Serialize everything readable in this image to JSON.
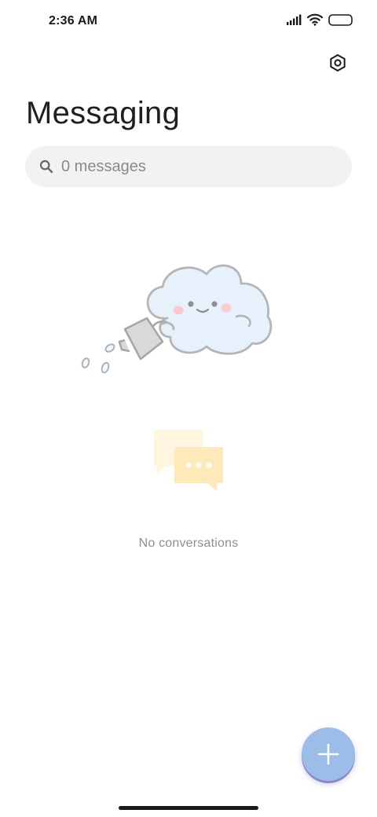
{
  "status_bar": {
    "time": "2:36 AM"
  },
  "header": {
    "title": "Messaging"
  },
  "search": {
    "placeholder": "0 messages",
    "value": ""
  },
  "empty_state": {
    "message": "No conversations"
  },
  "colors": {
    "fab": "#9bbde8",
    "search_bg": "#f2f2f2",
    "chat_bubble_back": "#fff6e0",
    "chat_bubble_front": "#ffe9b8",
    "cloud_fill": "#e6f1fc"
  },
  "icons": {
    "settings": "gear-icon",
    "search": "search-icon",
    "fab": "plus-icon",
    "signal": "signal-icon",
    "wifi": "wifi-icon",
    "battery": "battery-icon"
  }
}
